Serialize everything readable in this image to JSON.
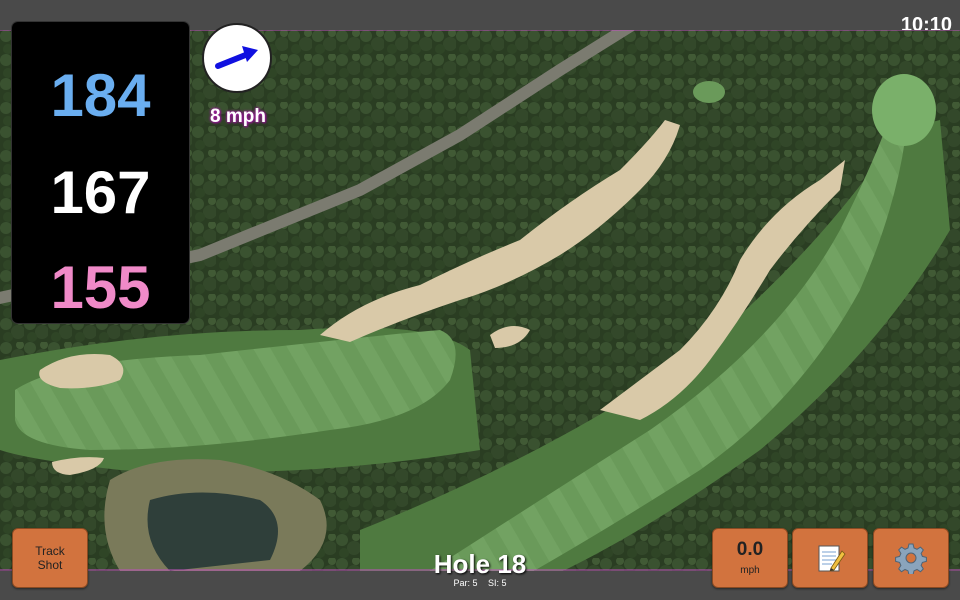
{
  "status": {
    "time": "10:10"
  },
  "distances": {
    "back": "184",
    "middle": "167",
    "front": "155"
  },
  "colors": {
    "back": "#6aaef0",
    "middle": "#ffffff",
    "front": "#f08ac8",
    "button": "#d2733e",
    "wind_arrow": "#1010e0"
  },
  "wind": {
    "speed_label": "8 mph",
    "arrow_icon": "wind-direction-arrow-icon"
  },
  "buttons": {
    "track_shot_line1": "Track",
    "track_shot_line2": "Shot",
    "speed_value": "0.0",
    "speed_unit": "mph",
    "notes_icon": "notepad-icon",
    "settings_icon": "gear-icon"
  },
  "hole": {
    "title": "Hole 18",
    "par": "Par: 5",
    "si": "SI: 5"
  }
}
